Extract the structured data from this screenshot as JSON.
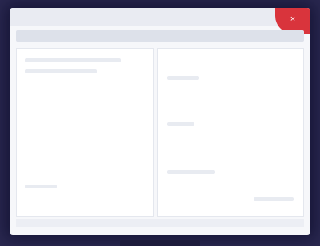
{
  "window": {
    "title": "",
    "close_glyph": "×"
  },
  "icons": {
    "close": "close-icon"
  },
  "colors": {
    "background": "#2a2850",
    "window": "#f6f7fa",
    "close_button": "#d9343c"
  }
}
